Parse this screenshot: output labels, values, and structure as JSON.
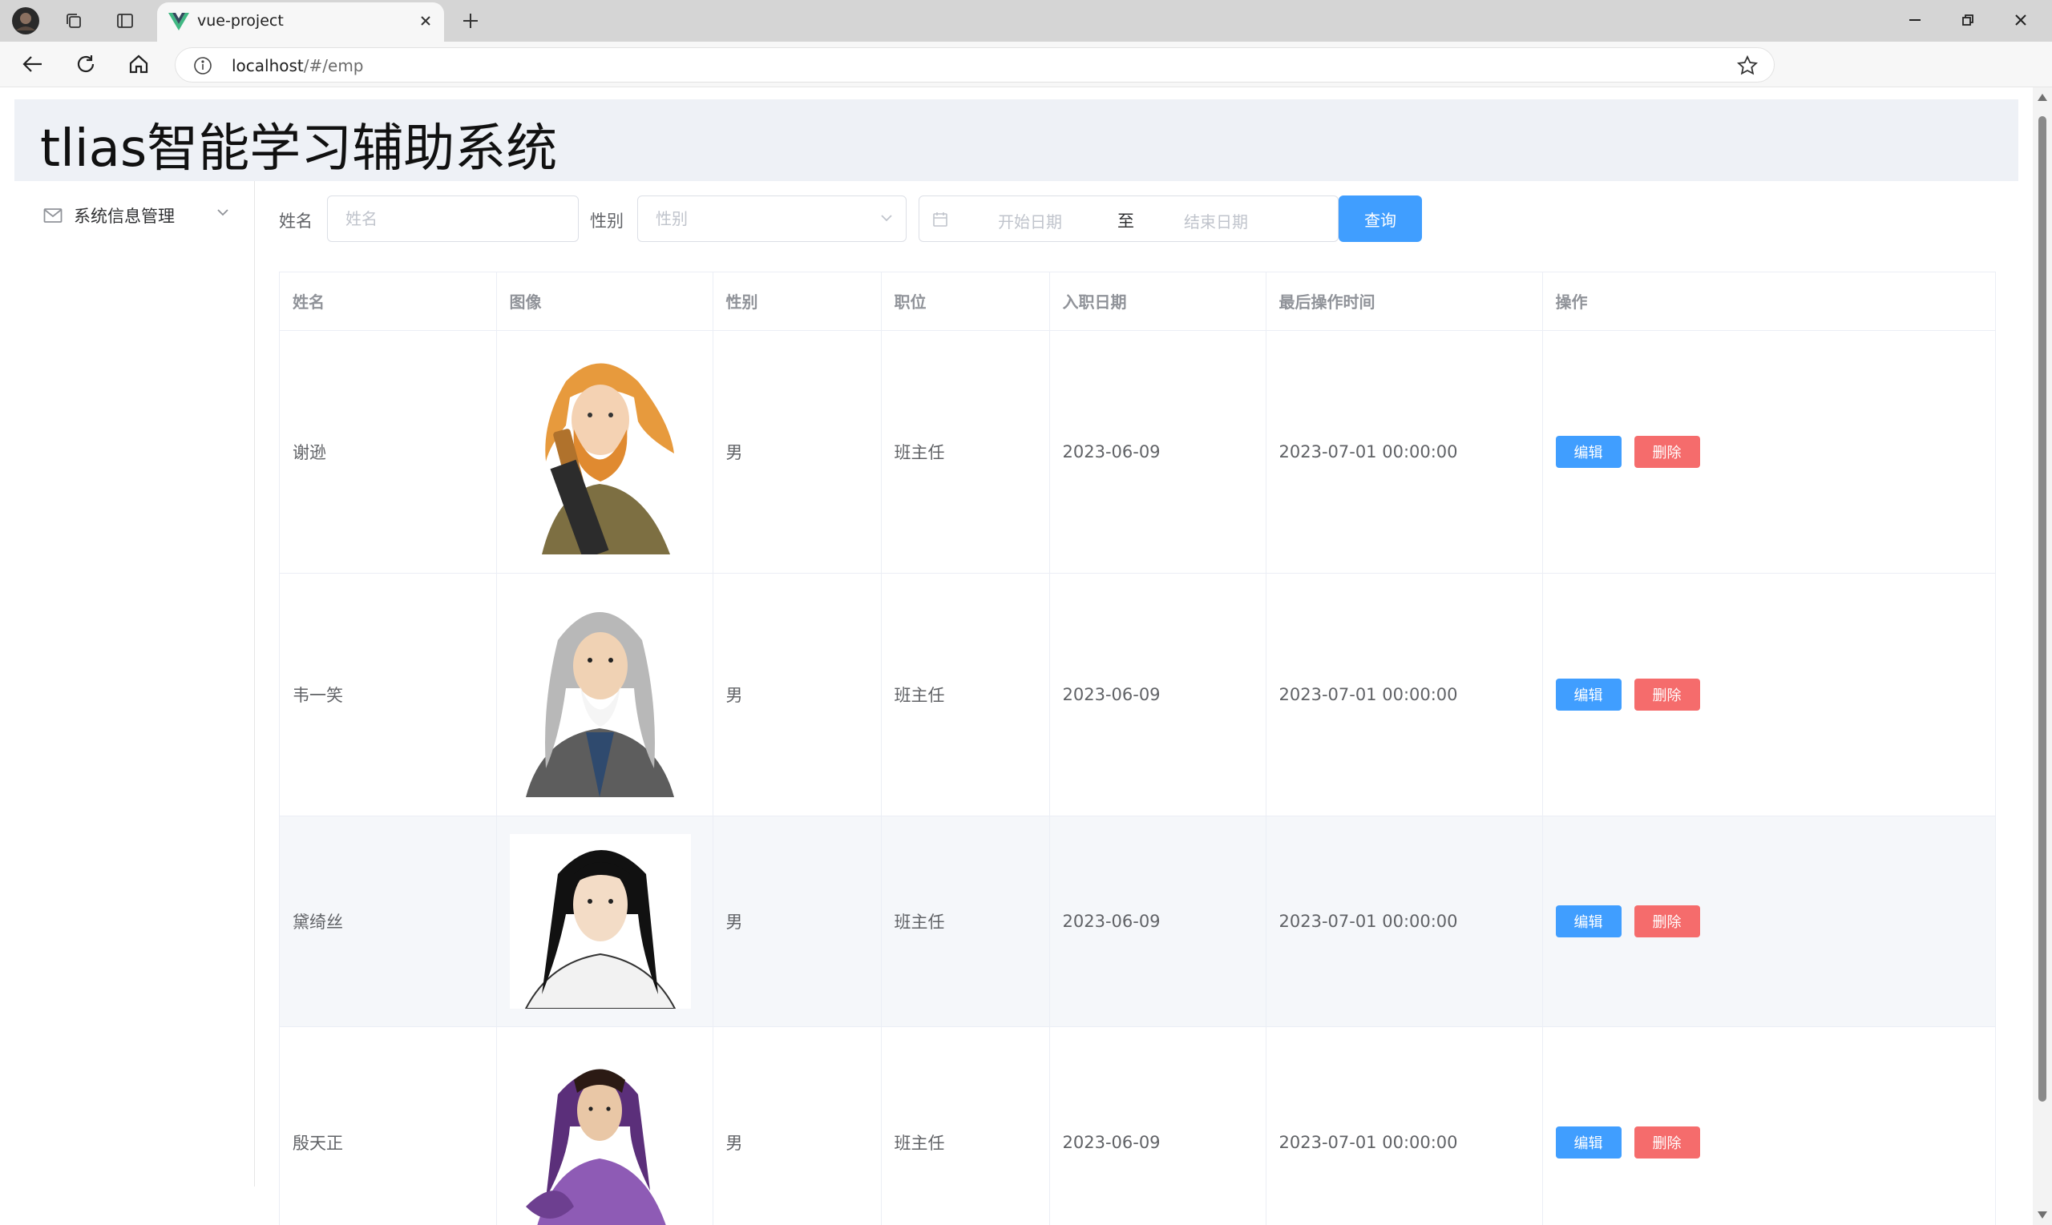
{
  "browser": {
    "tab_title": "vue-project",
    "url_host": "localhost",
    "url_path": "/#/emp"
  },
  "app": {
    "title": "tlias智能学习辅助系统"
  },
  "sidebar": {
    "items": [
      {
        "label": "系统信息管理",
        "icon": "mail-icon"
      }
    ]
  },
  "search": {
    "name_label": "姓名",
    "name_placeholder": "姓名",
    "gender_label": "性别",
    "gender_placeholder": "性别",
    "start_placeholder": "开始日期",
    "range_separator": "至",
    "end_placeholder": "结束日期",
    "query_button": "查询"
  },
  "table": {
    "headers": [
      "姓名",
      "图像",
      "性别",
      "职位",
      "入职日期",
      "最后操作时间",
      "操作"
    ],
    "edit_label": "编辑",
    "delete_label": "删除",
    "rows": [
      {
        "name": "谢逊",
        "avatar": "blond-bearded-warrior",
        "gender": "男",
        "position": "班主任",
        "entry_date": "2023-06-09",
        "update_time": "2023-07-01 00:00:00"
      },
      {
        "name": "韦一笑",
        "avatar": "gray-haired-elder",
        "gender": "男",
        "position": "班主任",
        "entry_date": "2023-06-09",
        "update_time": "2023-07-01 00:00:00"
      },
      {
        "name": "黛绮丝",
        "avatar": "black-haired-swordsman",
        "gender": "男",
        "position": "班主任",
        "entry_date": "2023-06-09",
        "update_time": "2023-07-01 00:00:00"
      },
      {
        "name": "殷天正",
        "avatar": "purple-robed-heroine",
        "gender": "男",
        "position": "班主任",
        "entry_date": "2023-06-09",
        "update_time": "2023-07-01 00:00:00"
      }
    ]
  },
  "colors": {
    "primary": "#409eff",
    "danger": "#f56c6c",
    "header_bg": "#eef1f6"
  }
}
